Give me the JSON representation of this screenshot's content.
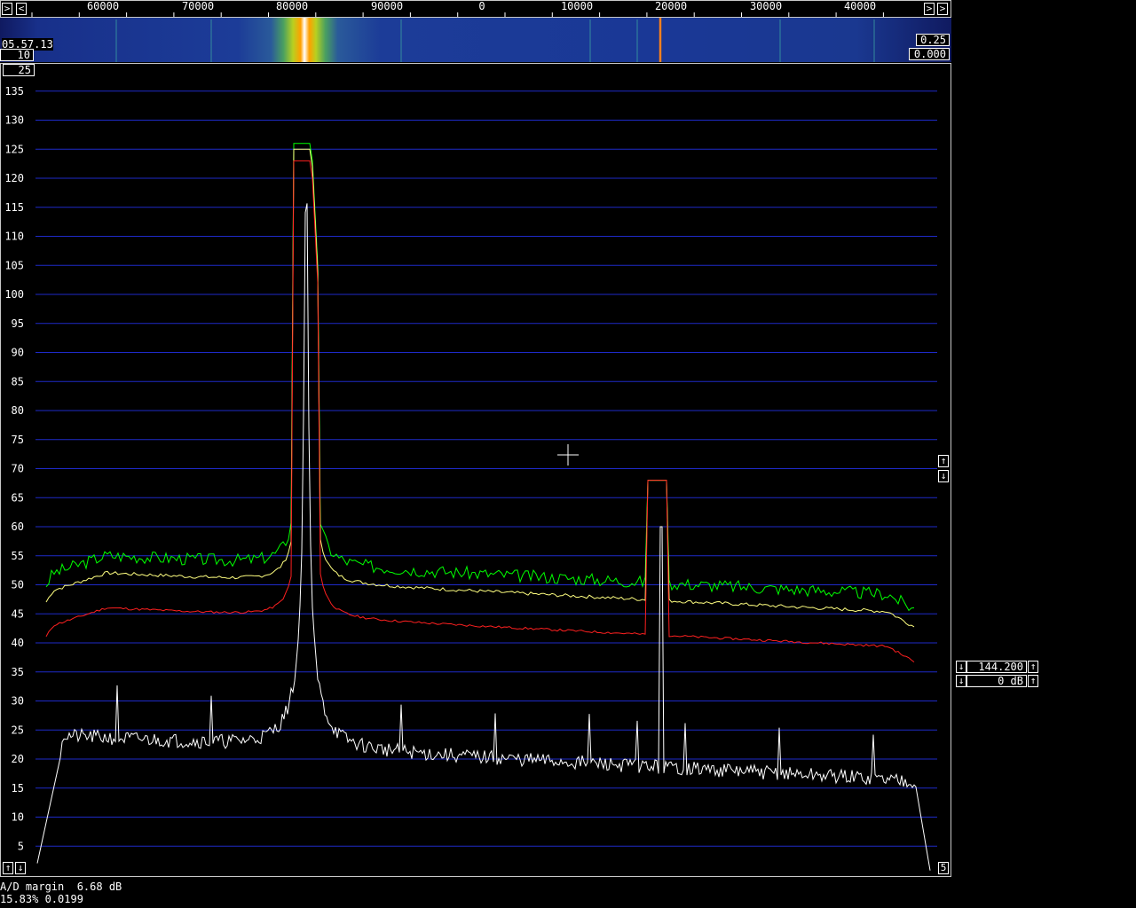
{
  "freq_scale": {
    "labels": [
      "60000",
      "70000",
      "80000",
      "90000",
      "0",
      "10000",
      "20000",
      "30000",
      "40000"
    ],
    "left_arrow": ">",
    "right_arrow": ">"
  },
  "waterfall": {
    "time": "05.57.13",
    "avg": "10",
    "gain": "0.25",
    "zero": "0.000"
  },
  "spectrum": {
    "top_box": "25",
    "bottom_box": "5",
    "y_ticks": [
      "135",
      "130",
      "125",
      "120",
      "115",
      "110",
      "105",
      "100",
      "95",
      "90",
      "85",
      "80",
      "75",
      "70",
      "65",
      "60",
      "55",
      "50",
      "45",
      "40",
      "35",
      "30",
      "25",
      "20",
      "15",
      "10",
      "5"
    ],
    "colors": {
      "green": "#00ff00",
      "yellow": "#ffff80",
      "red": "#ff2020",
      "white": "#ffffff",
      "grid": "#1e2ac8"
    }
  },
  "side_controls": {
    "up_arrow": "↑",
    "down_arrow": "↓",
    "frequency": "144.200",
    "gain": "0 dB"
  },
  "status": {
    "ad_margin": "A/D margin  6.68 dB",
    "cpu": "15.83% 0.0199"
  }
}
